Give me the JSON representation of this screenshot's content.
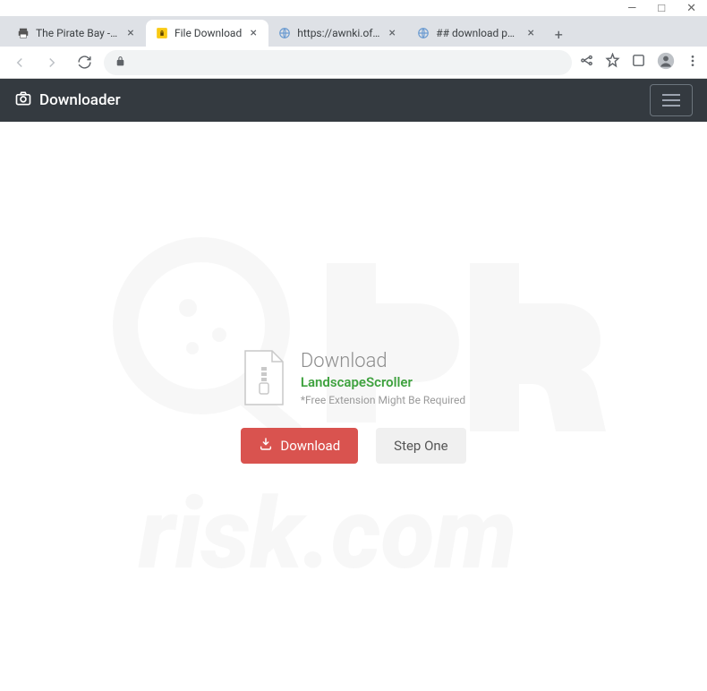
{
  "windowControls": {
    "minimize": "—",
    "maximize": "□",
    "close": "✕"
  },
  "tabs": [
    {
      "title": "The Pirate Bay - The ga..."
    },
    {
      "title": "File Download"
    },
    {
      "title": "https://awnki.ofchildr.b..."
    },
    {
      "title": "## download page ##"
    }
  ],
  "navbar": {
    "brand": "Downloader"
  },
  "card": {
    "title": "Download",
    "filename": "LandscapeScroller",
    "note": "*Free Extension Might Be Required",
    "downloadBtn": "Download",
    "stepBtn": "Step One"
  }
}
